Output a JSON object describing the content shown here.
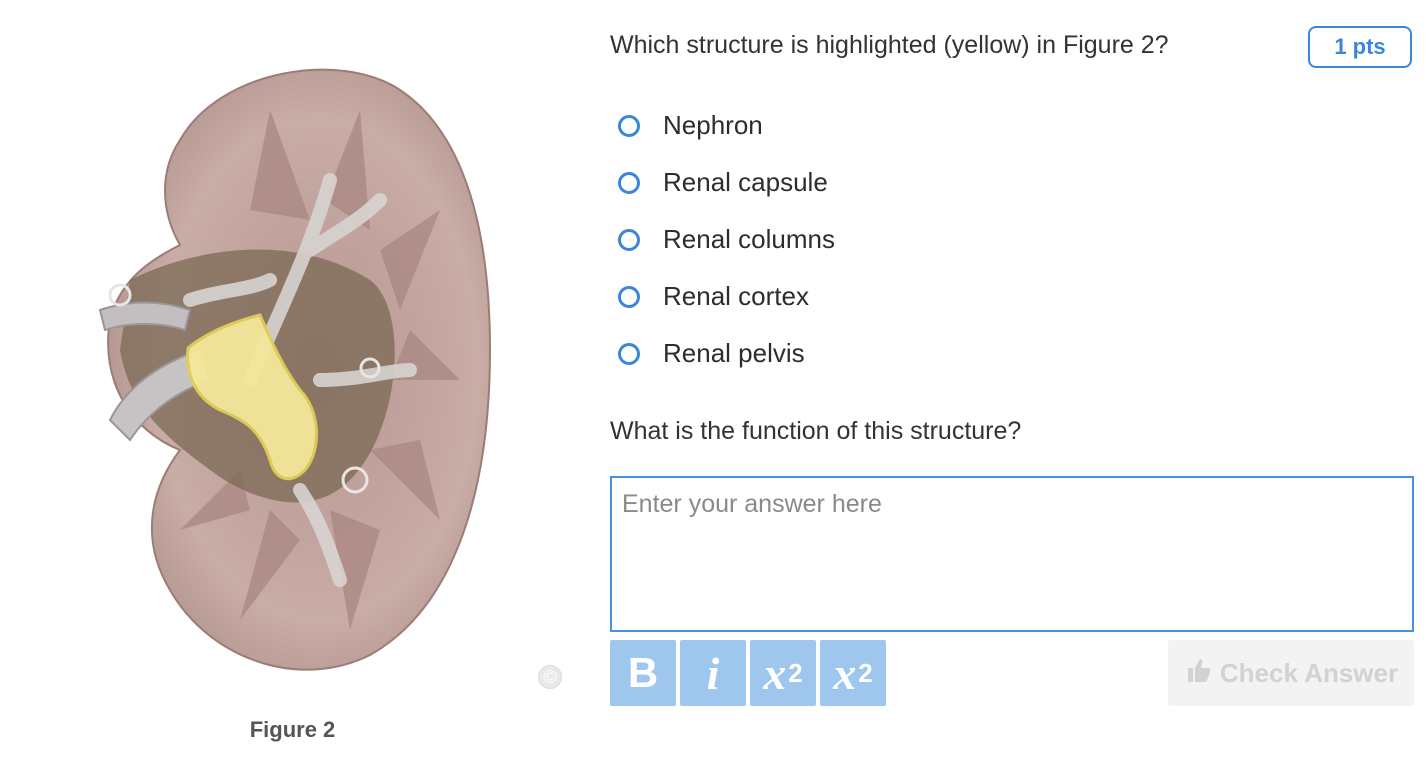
{
  "figure": {
    "caption": "Figure 2",
    "copyright_symbol": "©",
    "highlight_color": "#f3e89a"
  },
  "question1": {
    "text": "Which structure is highlighted (yellow) in Figure 2?",
    "points": "1 pts",
    "options": [
      {
        "label": "Nephron"
      },
      {
        "label": "Renal capsule"
      },
      {
        "label": "Renal columns"
      },
      {
        "label": "Renal cortex"
      },
      {
        "label": "Renal pelvis"
      }
    ]
  },
  "question2": {
    "text": "What is the function of this structure?",
    "placeholder": "Enter your answer here"
  },
  "toolbar": {
    "bold_label": "B",
    "italic_label": "i",
    "subscript_base": "x",
    "subscript_mark": "2",
    "superscript_base": "x",
    "superscript_mark": "2",
    "check_answer_label": "Check Answer",
    "check_answer_icon": "thumbs-up-icon"
  },
  "colors": {
    "accent": "#3b86d8",
    "toolbar_button": "#9fc7ee",
    "disabled_button": "#f3f3f3"
  }
}
